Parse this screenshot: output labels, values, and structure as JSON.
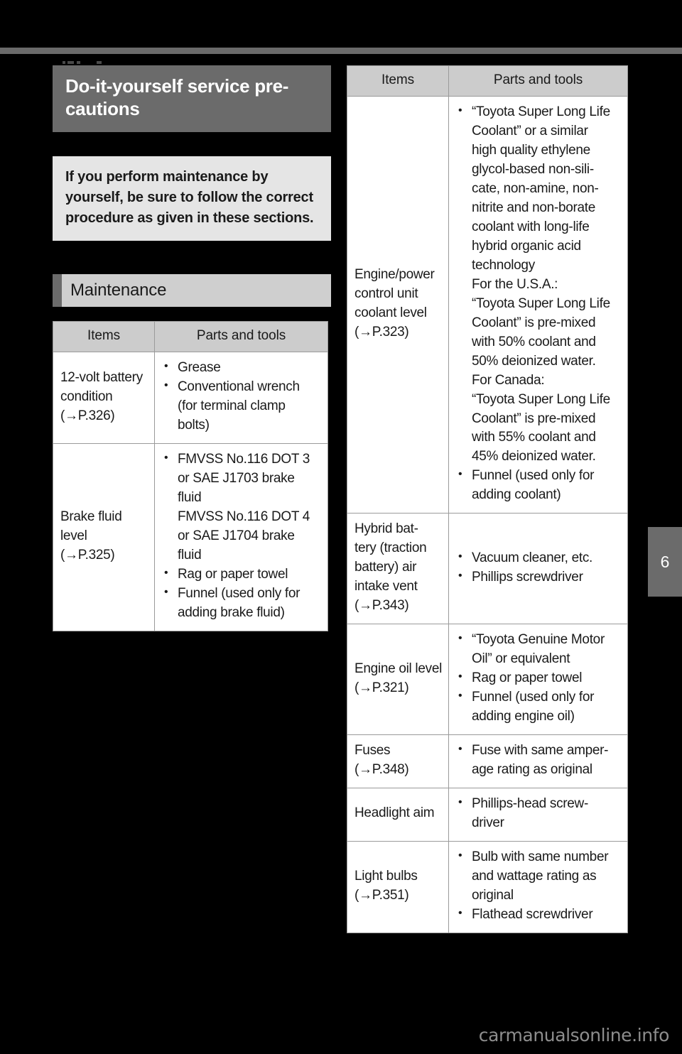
{
  "page": {
    "background_color": "#000000",
    "chapter_tab_number": "6",
    "watermark": "carmanualsonline.info"
  },
  "left_column": {
    "chapter_banner": {
      "title": "Do-it-yourself service pre-cautions",
      "background_color": "#6b6b6b",
      "text_color": "#ffffff"
    },
    "note_box": {
      "text": "If you perform maintenance by yourself, be sure to follow the correct procedure as given in these sections.",
      "background_color": "#e5e5e5"
    },
    "section_heading": {
      "label": "Maintenance",
      "accent_color": "#6b6b6b",
      "background_color": "#cfcfcf"
    },
    "table": {
      "headers": [
        "Items",
        "Parts and tools"
      ],
      "rows": [
        {
          "item": "12-volt battery condition",
          "item_ref": "(→P.326)",
          "tools": [
            {
              "bullet": true,
              "lines": [
                "Grease"
              ]
            },
            {
              "bullet": true,
              "lines": [
                "Conventional wrench",
                "(for terminal clamp",
                "bolts)"
              ]
            }
          ]
        },
        {
          "item": "Brake fluid level",
          "item_ref": "(→P.325)",
          "tools": [
            {
              "bullet": true,
              "lines": [
                "FMVSS No.116 DOT 3",
                "or SAE J1703 brake",
                "fluid"
              ]
            },
            {
              "bullet": false,
              "lines": [
                "FMVSS No.116 DOT 4",
                "or SAE J1704 brake",
                "fluid"
              ]
            },
            {
              "bullet": true,
              "lines": [
                "Rag or paper towel"
              ]
            },
            {
              "bullet": true,
              "lines": [
                "Funnel (used only for",
                "adding brake fluid)"
              ]
            }
          ]
        }
      ]
    }
  },
  "right_column": {
    "table": {
      "headers": [
        "Items",
        "Parts and tools"
      ],
      "rows": [
        {
          "item": "Engine/power control unit coolant level",
          "item_ref": "(→P.323)",
          "tools": [
            {
              "bullet": true,
              "lines": [
                "“Toyota Super Long Life",
                "Coolant” or a similar",
                "high quality ethylene",
                "glycol-based non-sili-",
                "cate, non-amine, non-",
                "nitrite and non-borate",
                "coolant with long-life",
                "hybrid organic acid",
                "technology"
              ]
            },
            {
              "bullet": false,
              "lines": [
                "For the U.S.A.:",
                "“Toyota Super Long Life",
                "Coolant” is pre-mixed",
                "with 50% coolant and",
                "50% deionized water.",
                "For Canada:",
                "“Toyota Super Long Life",
                "Coolant” is pre-mixed",
                "with 55% coolant and",
                "45% deionized water."
              ]
            },
            {
              "bullet": true,
              "lines": [
                "Funnel (used only for",
                "adding coolant)"
              ]
            }
          ]
        },
        {
          "item": "Hybrid battery (traction battery) air intake vent",
          "item_ref": "(→P.343)",
          "item_lines": [
            "Hybrid bat-",
            "tery (traction",
            "battery) air",
            "intake vent"
          ],
          "tools": [
            {
              "bullet": true,
              "lines": [
                "Vacuum cleaner, etc."
              ]
            },
            {
              "bullet": true,
              "lines": [
                "Phillips screwdriver"
              ]
            }
          ]
        },
        {
          "item": "Engine oil level",
          "item_ref": "(→P.321)",
          "tools": [
            {
              "bullet": true,
              "lines": [
                "“Toyota Genuine Motor",
                "Oil” or equivalent"
              ]
            },
            {
              "bullet": true,
              "lines": [
                "Rag or paper towel"
              ]
            },
            {
              "bullet": true,
              "lines": [
                "Funnel (used only for",
                "adding engine oil)"
              ]
            }
          ]
        },
        {
          "item": "Fuses",
          "item_ref": "(→P.348)",
          "tools": [
            {
              "bullet": true,
              "lines": [
                "Fuse with same amper-",
                "age rating as original"
              ]
            }
          ]
        },
        {
          "item": "Headlight aim",
          "item_ref": "",
          "tools": [
            {
              "bullet": true,
              "lines": [
                "Phillips-head screw-",
                "driver"
              ]
            }
          ]
        },
        {
          "item": "Light bulbs",
          "item_ref": "(→P.351)",
          "tools": [
            {
              "bullet": true,
              "lines": [
                "Bulb with same number",
                "and wattage rating as",
                "original"
              ]
            },
            {
              "bullet": true,
              "lines": [
                "Flathead screwdriver"
              ]
            }
          ]
        }
      ]
    }
  }
}
